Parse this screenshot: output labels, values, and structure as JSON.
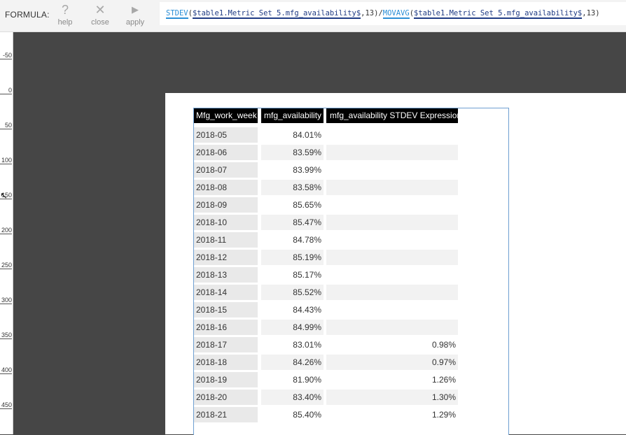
{
  "toolbar": {
    "formula_label": "FORMULA:",
    "buttons": [
      {
        "icon": "question-mark-icon",
        "glyph": "?",
        "label": "help"
      },
      {
        "icon": "close-icon",
        "glyph": "✕",
        "label": "close"
      },
      {
        "icon": "play-icon",
        "glyph": "▶",
        "label": "apply"
      }
    ],
    "formula": {
      "fn1": "STDEV",
      "open1": "(",
      "ref1": "$table1.Metric Set 5.mfg_availability$",
      "arg1": ",13)/",
      "fn2": "MOVAVG",
      "open2": "(",
      "ref2": "$table1.Metric Set 5.mfg_availability$",
      "arg2": ",13)"
    }
  },
  "ruler": {
    "ticks": [
      "-50",
      "0",
      "50",
      "100",
      "150",
      "200",
      "250",
      "300",
      "350",
      "400",
      "450"
    ]
  },
  "table": {
    "headers": [
      "Mfg_work_week",
      "mfg_availability",
      "mfg_availability STDEV Expression"
    ],
    "rows": [
      [
        "2018-05",
        "84.01%",
        ""
      ],
      [
        "2018-06",
        "83.59%",
        ""
      ],
      [
        "2018-07",
        "83.99%",
        ""
      ],
      [
        "2018-08",
        "83.58%",
        ""
      ],
      [
        "2018-09",
        "85.65%",
        ""
      ],
      [
        "2018-10",
        "85.47%",
        ""
      ],
      [
        "2018-11",
        "84.78%",
        ""
      ],
      [
        "2018-12",
        "85.19%",
        ""
      ],
      [
        "2018-13",
        "85.17%",
        ""
      ],
      [
        "2018-14",
        "85.52%",
        ""
      ],
      [
        "2018-15",
        "84.43%",
        ""
      ],
      [
        "2018-16",
        "84.99%",
        ""
      ],
      [
        "2018-17",
        "83.01%",
        "0.98%"
      ],
      [
        "2018-18",
        "84.26%",
        "0.97%"
      ],
      [
        "2018-19",
        "81.90%",
        "1.26%"
      ],
      [
        "2018-20",
        "83.40%",
        "1.30%"
      ],
      [
        "2018-21",
        "85.40%",
        "1.29%"
      ]
    ]
  }
}
